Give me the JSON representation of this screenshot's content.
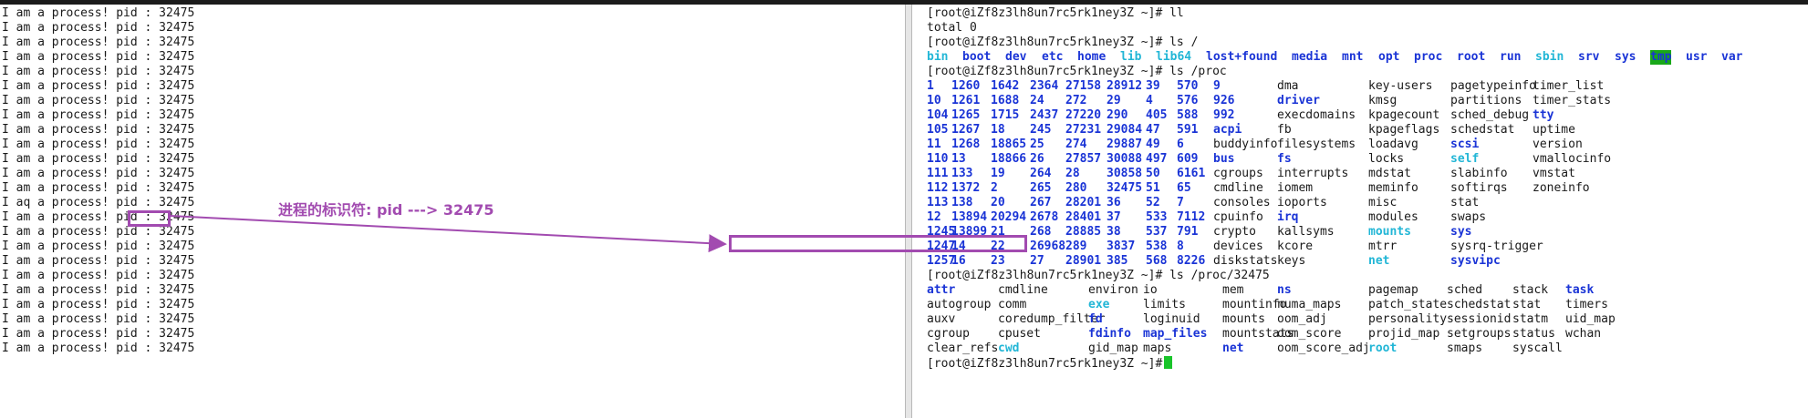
{
  "left_terminal": {
    "line_text": "I am a process! pid : 32475",
    "line_count": 23,
    "glitch_line": {
      "index": 13,
      "text": "I aq a process! pid : 32475"
    },
    "partial_last_line": "I am a process! pid : 32475"
  },
  "annotation": {
    "label": "进程的标识符: pid ---> 32475",
    "color": "#a24bb0"
  },
  "right_terminal": {
    "prompt": "[root@iZf8z3lh8un7rc5rk1ney3Z ~]#",
    "cmd_ll": "ll",
    "total_line": "total 0",
    "cmd_ls_root": "ls /",
    "root_listing": [
      {
        "t": "bin",
        "s": "link"
      },
      {
        "t": "boot",
        "s": "dir"
      },
      {
        "t": "dev",
        "s": "dir"
      },
      {
        "t": "etc",
        "s": "dir"
      },
      {
        "t": "home",
        "s": "dir"
      },
      {
        "t": "lib",
        "s": "link"
      },
      {
        "t": "lib64",
        "s": "link"
      },
      {
        "t": "lost+found",
        "s": "dir"
      },
      {
        "t": "media",
        "s": "dir"
      },
      {
        "t": "mnt",
        "s": "dir"
      },
      {
        "t": "opt",
        "s": "dir"
      },
      {
        "t": "proc",
        "s": "dir"
      },
      {
        "t": "root",
        "s": "dir"
      },
      {
        "t": "run",
        "s": "dir"
      },
      {
        "t": "sbin",
        "s": "link"
      },
      {
        "t": "srv",
        "s": "dir"
      },
      {
        "t": "sys",
        "s": "dir"
      },
      {
        "t": "tmp",
        "s": "hl"
      },
      {
        "t": "usr",
        "s": "dir"
      },
      {
        "t": "var",
        "s": "dir"
      }
    ],
    "cmd_ls_proc": "ls /proc",
    "proc_rows": [
      [
        {
          "t": "1",
          "s": "dir"
        },
        {
          "t": "1260",
          "s": "dir"
        },
        {
          "t": "1642",
          "s": "dir"
        },
        {
          "t": "2364",
          "s": "dir"
        },
        {
          "t": "27158",
          "s": "dir"
        },
        {
          "t": "28912",
          "s": "dir"
        },
        {
          "t": "39",
          "s": "dir"
        },
        {
          "t": "570",
          "s": "dir"
        },
        {
          "t": "9",
          "s": "dir"
        },
        {
          "t": "dma",
          "s": ""
        },
        {
          "t": "key-users",
          "s": ""
        },
        {
          "t": "pagetypeinfo",
          "s": ""
        },
        {
          "t": "timer_list",
          "s": ""
        }
      ],
      [
        {
          "t": "10",
          "s": "dir"
        },
        {
          "t": "1261",
          "s": "dir"
        },
        {
          "t": "1688",
          "s": "dir"
        },
        {
          "t": "24",
          "s": "dir"
        },
        {
          "t": "272",
          "s": "dir"
        },
        {
          "t": "29",
          "s": "dir"
        },
        {
          "t": "4",
          "s": "dir"
        },
        {
          "t": "576",
          "s": "dir"
        },
        {
          "t": "926",
          "s": "dir"
        },
        {
          "t": "driver",
          "s": "dir"
        },
        {
          "t": "kmsg",
          "s": ""
        },
        {
          "t": "partitions",
          "s": ""
        },
        {
          "t": "timer_stats",
          "s": ""
        }
      ],
      [
        {
          "t": "104",
          "s": "dir"
        },
        {
          "t": "1265",
          "s": "dir"
        },
        {
          "t": "1715",
          "s": "dir"
        },
        {
          "t": "2437",
          "s": "dir"
        },
        {
          "t": "27220",
          "s": "dir"
        },
        {
          "t": "290",
          "s": "dir"
        },
        {
          "t": "405",
          "s": "dir"
        },
        {
          "t": "588",
          "s": "dir"
        },
        {
          "t": "992",
          "s": "dir"
        },
        {
          "t": "execdomains",
          "s": ""
        },
        {
          "t": "kpagecount",
          "s": ""
        },
        {
          "t": "sched_debug",
          "s": ""
        },
        {
          "t": "tty",
          "s": "dir"
        }
      ],
      [
        {
          "t": "105",
          "s": "dir"
        },
        {
          "t": "1267",
          "s": "dir"
        },
        {
          "t": "18",
          "s": "dir"
        },
        {
          "t": "245",
          "s": "dir"
        },
        {
          "t": "27231",
          "s": "dir"
        },
        {
          "t": "29084",
          "s": "dir"
        },
        {
          "t": "47",
          "s": "dir"
        },
        {
          "t": "591",
          "s": "dir"
        },
        {
          "t": "acpi",
          "s": "dir"
        },
        {
          "t": "fb",
          "s": ""
        },
        {
          "t": "kpageflags",
          "s": ""
        },
        {
          "t": "schedstat",
          "s": ""
        },
        {
          "t": "uptime",
          "s": ""
        }
      ],
      [
        {
          "t": "11",
          "s": "dir"
        },
        {
          "t": "1268",
          "s": "dir"
        },
        {
          "t": "18865",
          "s": "dir"
        },
        {
          "t": "25",
          "s": "dir"
        },
        {
          "t": "274",
          "s": "dir"
        },
        {
          "t": "29887",
          "s": "dir"
        },
        {
          "t": "49",
          "s": "dir"
        },
        {
          "t": "6",
          "s": "dir"
        },
        {
          "t": "buddyinfo",
          "s": ""
        },
        {
          "t": "filesystems",
          "s": ""
        },
        {
          "t": "loadavg",
          "s": ""
        },
        {
          "t": "scsi",
          "s": "dir"
        },
        {
          "t": "version",
          "s": ""
        }
      ],
      [
        {
          "t": "110",
          "s": "dir"
        },
        {
          "t": "13",
          "s": "dir"
        },
        {
          "t": "18866",
          "s": "dir"
        },
        {
          "t": "26",
          "s": "dir"
        },
        {
          "t": "27857",
          "s": "dir"
        },
        {
          "t": "30088",
          "s": "dir"
        },
        {
          "t": "497",
          "s": "dir"
        },
        {
          "t": "609",
          "s": "dir"
        },
        {
          "t": "bus",
          "s": "dir"
        },
        {
          "t": "fs",
          "s": "dir"
        },
        {
          "t": "locks",
          "s": ""
        },
        {
          "t": "self",
          "s": "link"
        },
        {
          "t": "vmallocinfo",
          "s": ""
        }
      ],
      [
        {
          "t": "111",
          "s": "dir"
        },
        {
          "t": "133",
          "s": "dir"
        },
        {
          "t": "19",
          "s": "dir"
        },
        {
          "t": "264",
          "s": "dir"
        },
        {
          "t": "28",
          "s": "dir"
        },
        {
          "t": "30858",
          "s": "dir"
        },
        {
          "t": "50",
          "s": "dir"
        },
        {
          "t": "6161",
          "s": "dir"
        },
        {
          "t": "cgroups",
          "s": ""
        },
        {
          "t": "interrupts",
          "s": ""
        },
        {
          "t": "mdstat",
          "s": ""
        },
        {
          "t": "slabinfo",
          "s": ""
        },
        {
          "t": "vmstat",
          "s": ""
        }
      ],
      [
        {
          "t": "112",
          "s": "dir"
        },
        {
          "t": "1372",
          "s": "dir"
        },
        {
          "t": "2",
          "s": "dir"
        },
        {
          "t": "265",
          "s": "dir"
        },
        {
          "t": "280",
          "s": "dir"
        },
        {
          "t": "32475",
          "s": "dir"
        },
        {
          "t": "51",
          "s": "dir"
        },
        {
          "t": "65",
          "s": "dir"
        },
        {
          "t": "cmdline",
          "s": ""
        },
        {
          "t": "iomem",
          "s": ""
        },
        {
          "t": "meminfo",
          "s": ""
        },
        {
          "t": "softirqs",
          "s": ""
        },
        {
          "t": "zoneinfo",
          "s": ""
        }
      ],
      [
        {
          "t": "113",
          "s": "dir"
        },
        {
          "t": "138",
          "s": "dir"
        },
        {
          "t": "20",
          "s": "dir"
        },
        {
          "t": "267",
          "s": "dir"
        },
        {
          "t": "28201",
          "s": "dir"
        },
        {
          "t": "36",
          "s": "dir"
        },
        {
          "t": "52",
          "s": "dir"
        },
        {
          "t": "7",
          "s": "dir"
        },
        {
          "t": "consoles",
          "s": ""
        },
        {
          "t": "ioports",
          "s": ""
        },
        {
          "t": "misc",
          "s": ""
        },
        {
          "t": "stat",
          "s": ""
        },
        {
          "t": "",
          "s": ""
        }
      ],
      [
        {
          "t": "12",
          "s": "dir"
        },
        {
          "t": "13894",
          "s": "dir"
        },
        {
          "t": "20294",
          "s": "dir"
        },
        {
          "t": "2678",
          "s": "dir"
        },
        {
          "t": "28401",
          "s": "dir"
        },
        {
          "t": "37",
          "s": "dir"
        },
        {
          "t": "533",
          "s": "dir"
        },
        {
          "t": "7112",
          "s": "dir"
        },
        {
          "t": "cpuinfo",
          "s": ""
        },
        {
          "t": "irq",
          "s": "dir"
        },
        {
          "t": "modules",
          "s": ""
        },
        {
          "t": "swaps",
          "s": ""
        },
        {
          "t": "",
          "s": ""
        }
      ],
      [
        {
          "t": "1245",
          "s": "dir"
        },
        {
          "t": "13899",
          "s": "dir"
        },
        {
          "t": "21",
          "s": "dir"
        },
        {
          "t": "268",
          "s": "dir"
        },
        {
          "t": "28885",
          "s": "dir"
        },
        {
          "t": "38",
          "s": "dir"
        },
        {
          "t": "537",
          "s": "dir"
        },
        {
          "t": "791",
          "s": "dir"
        },
        {
          "t": "crypto",
          "s": ""
        },
        {
          "t": "kallsyms",
          "s": ""
        },
        {
          "t": "mounts",
          "s": "link"
        },
        {
          "t": "sys",
          "s": "dir"
        },
        {
          "t": "",
          "s": ""
        }
      ],
      [
        {
          "t": "1247",
          "s": "dir"
        },
        {
          "t": "14",
          "s": "dir"
        },
        {
          "t": "22",
          "s": "dir"
        },
        {
          "t": "26968",
          "s": "dir"
        },
        {
          "t": "289",
          "s": "dir"
        },
        {
          "t": "3837",
          "s": "dir"
        },
        {
          "t": "538",
          "s": "dir"
        },
        {
          "t": "8",
          "s": "dir"
        },
        {
          "t": "devices",
          "s": ""
        },
        {
          "t": "kcore",
          "s": ""
        },
        {
          "t": "mtrr",
          "s": ""
        },
        {
          "t": "sysrq-trigger",
          "s": ""
        },
        {
          "t": "",
          "s": ""
        }
      ],
      [
        {
          "t": "1257",
          "s": "dir"
        },
        {
          "t": "16",
          "s": "dir"
        },
        {
          "t": "23",
          "s": "dir"
        },
        {
          "t": "27",
          "s": "dir"
        },
        {
          "t": "28901",
          "s": "dir"
        },
        {
          "t": "385",
          "s": "dir"
        },
        {
          "t": "568",
          "s": "dir"
        },
        {
          "t": "8226",
          "s": "dir"
        },
        {
          "t": "diskstats",
          "s": ""
        },
        {
          "t": "keys",
          "s": ""
        },
        {
          "t": "net",
          "s": "link"
        },
        {
          "t": "sysvipc",
          "s": "dir"
        },
        {
          "t": "",
          "s": ""
        }
      ]
    ],
    "cmd_ls_pid": "ls /proc/32475",
    "pid_rows": [
      [
        {
          "t": "attr",
          "s": "dir"
        },
        {
          "t": "cmdline",
          "s": ""
        },
        {
          "t": "environ",
          "s": ""
        },
        {
          "t": "io",
          "s": ""
        },
        {
          "t": "mem",
          "s": ""
        },
        {
          "t": "ns",
          "s": "dir"
        },
        {
          "t": "pagemap",
          "s": ""
        },
        {
          "t": "sched",
          "s": ""
        },
        {
          "t": "stack",
          "s": ""
        },
        {
          "t": "task",
          "s": "dir"
        }
      ],
      [
        {
          "t": "autogroup",
          "s": ""
        },
        {
          "t": "comm",
          "s": ""
        },
        {
          "t": "exe",
          "s": "link"
        },
        {
          "t": "limits",
          "s": ""
        },
        {
          "t": "mountinfo",
          "s": ""
        },
        {
          "t": "numa_maps",
          "s": ""
        },
        {
          "t": "patch_state",
          "s": ""
        },
        {
          "t": "schedstat",
          "s": ""
        },
        {
          "t": "stat",
          "s": ""
        },
        {
          "t": "timers",
          "s": ""
        }
      ],
      [
        {
          "t": "auxv",
          "s": ""
        },
        {
          "t": "coredump_filter",
          "s": ""
        },
        {
          "t": "fd",
          "s": "dir"
        },
        {
          "t": "loginuid",
          "s": ""
        },
        {
          "t": "mounts",
          "s": ""
        },
        {
          "t": "oom_adj",
          "s": ""
        },
        {
          "t": "personality",
          "s": ""
        },
        {
          "t": "sessionid",
          "s": ""
        },
        {
          "t": "statm",
          "s": ""
        },
        {
          "t": "uid_map",
          "s": ""
        }
      ],
      [
        {
          "t": "cgroup",
          "s": ""
        },
        {
          "t": "cpuset",
          "s": ""
        },
        {
          "t": "fdinfo",
          "s": "dir"
        },
        {
          "t": "map_files",
          "s": "dir"
        },
        {
          "t": "mountstats",
          "s": ""
        },
        {
          "t": "oom_score",
          "s": ""
        },
        {
          "t": "projid_map",
          "s": ""
        },
        {
          "t": "setgroups",
          "s": ""
        },
        {
          "t": "status",
          "s": ""
        },
        {
          "t": "wchan",
          "s": ""
        }
      ],
      [
        {
          "t": "clear_refs",
          "s": ""
        },
        {
          "t": "cwd",
          "s": "link"
        },
        {
          "t": "gid_map",
          "s": ""
        },
        {
          "t": "maps",
          "s": ""
        },
        {
          "t": "net",
          "s": "dir"
        },
        {
          "t": "oom_score_adj",
          "s": ""
        },
        {
          "t": "root",
          "s": "link"
        },
        {
          "t": "smaps",
          "s": ""
        },
        {
          "t": "syscall",
          "s": ""
        },
        {
          "t": "",
          "s": ""
        }
      ]
    ]
  }
}
